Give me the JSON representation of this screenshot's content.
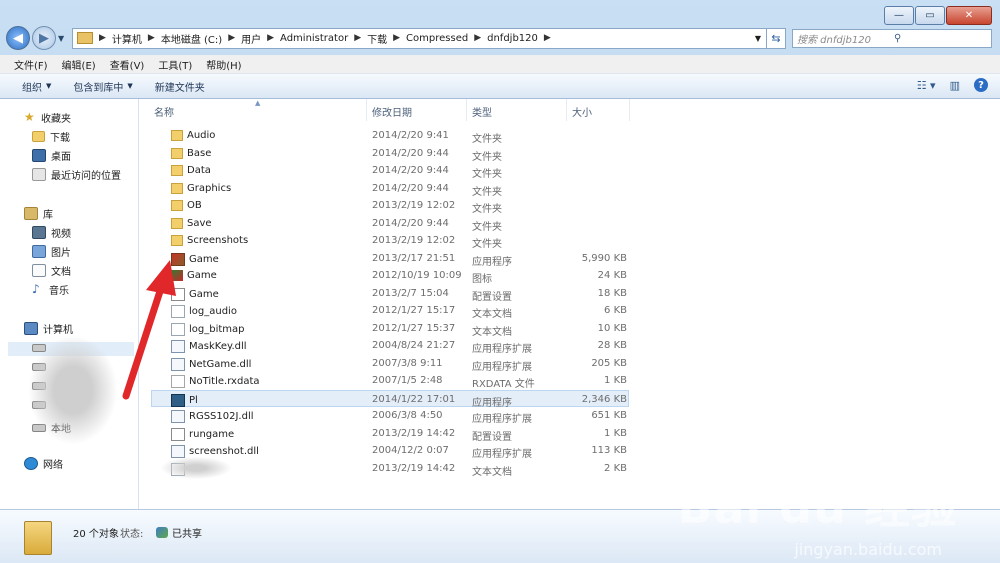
{
  "window": {
    "controls": [
      "—",
      "▭",
      "✕"
    ]
  },
  "address": {
    "crumbs": [
      "计算机",
      "本地磁盘 (C:)",
      "用户",
      "Administrator",
      "下载",
      "Compressed",
      "dnfdjb120"
    ],
    "search_placeholder": "搜索 dnfdjb120"
  },
  "menu": [
    "文件(F)",
    "编辑(E)",
    "查看(V)",
    "工具(T)",
    "帮助(H)"
  ],
  "toolbar": {
    "organize": "组织",
    "include_library": "包含到库中",
    "new_folder": "新建文件夹"
  },
  "nav": {
    "favorites": "收藏夹",
    "fav_items": [
      "下载",
      "桌面",
      "最近访问的位置"
    ],
    "libraries": "库",
    "lib_items": [
      "视频",
      "图片",
      "文档",
      "音乐"
    ],
    "computer": "计算机",
    "drive_partial": "本地",
    "network": "网络"
  },
  "columns": {
    "name": "名称",
    "date": "修改日期",
    "type": "类型",
    "size": "大小"
  },
  "files": [
    {
      "name": "Audio",
      "date": "2014/2/20 9:41",
      "type": "文件夹",
      "size": "",
      "icon": "folder"
    },
    {
      "name": "Base",
      "date": "2014/2/20 9:44",
      "type": "文件夹",
      "size": "",
      "icon": "folder"
    },
    {
      "name": "Data",
      "date": "2014/2/20 9:44",
      "type": "文件夹",
      "size": "",
      "icon": "folder"
    },
    {
      "name": "Graphics",
      "date": "2014/2/20 9:44",
      "type": "文件夹",
      "size": "",
      "icon": "folder"
    },
    {
      "name": "OB",
      "date": "2013/2/19 12:02",
      "type": "文件夹",
      "size": "",
      "icon": "folder"
    },
    {
      "name": "Save",
      "date": "2014/2/20 9:44",
      "type": "文件夹",
      "size": "",
      "icon": "folder"
    },
    {
      "name": "Screenshots",
      "date": "2013/2/19 12:02",
      "type": "文件夹",
      "size": "",
      "icon": "folder"
    },
    {
      "name": "Game",
      "date": "2013/2/17 21:51",
      "type": "应用程序",
      "size": "5,990 KB",
      "icon": "exe"
    },
    {
      "name": "Game",
      "date": "2012/10/19 10:09",
      "type": "图标",
      "size": "24 KB",
      "icon": "ico"
    },
    {
      "name": "Game",
      "date": "2013/2/7 15:04",
      "type": "配置设置",
      "size": "18 KB",
      "icon": "ini"
    },
    {
      "name": "log_audio",
      "date": "2012/1/27 15:17",
      "type": "文本文档",
      "size": "6 KB",
      "icon": "txt"
    },
    {
      "name": "log_bitmap",
      "date": "2012/1/27 15:37",
      "type": "文本文档",
      "size": "10 KB",
      "icon": "txt"
    },
    {
      "name": "MaskKey.dll",
      "date": "2004/8/24 21:27",
      "type": "应用程序扩展",
      "size": "28 KB",
      "icon": "dll"
    },
    {
      "name": "NetGame.dll",
      "date": "2007/3/8 9:11",
      "type": "应用程序扩展",
      "size": "205 KB",
      "icon": "dll"
    },
    {
      "name": "NoTitle.rxdata",
      "date": "2007/1/5 2:48",
      "type": "RXDATA 文件",
      "size": "1 KB",
      "icon": "rx"
    },
    {
      "name": "Pl",
      "date": "2014/1/22 17:01",
      "type": "应用程序",
      "size": "2,346 KB",
      "icon": "app",
      "selected": true
    },
    {
      "name": "RGSS102J.dll",
      "date": "2006/3/8 4:50",
      "type": "应用程序扩展",
      "size": "651 KB",
      "icon": "dll"
    },
    {
      "name": "rungame",
      "date": "2013/2/19 14:42",
      "type": "配置设置",
      "size": "1 KB",
      "icon": "ini"
    },
    {
      "name": "screenshot.dll",
      "date": "2004/12/2 0:07",
      "type": "应用程序扩展",
      "size": "113 KB",
      "icon": "dll"
    },
    {
      "name": "",
      "date": "2013/2/19 14:42",
      "type": "文本文档",
      "size": "2 KB",
      "icon": "txt"
    }
  ],
  "status": {
    "count": "20 个对象",
    "state_label": "状态:",
    "state_value": "已共享"
  },
  "watermark": {
    "main": "Bai du 经验",
    "sub": "jingyan.baidu.com"
  }
}
